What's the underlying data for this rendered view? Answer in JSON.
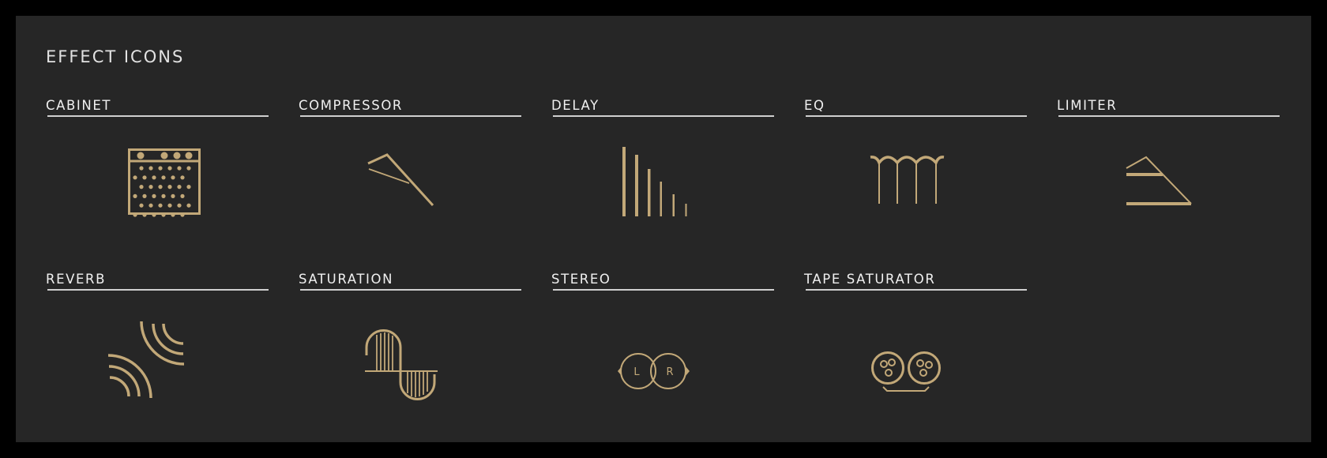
{
  "page": {
    "title": "EFFECT ICONS"
  },
  "colors": {
    "background": "#000000",
    "panel": "#262626",
    "icon": "#c2a878",
    "text": "#efefef",
    "rule": "#cfcfcf"
  },
  "effects": [
    {
      "label": "CABINET",
      "icon": "cabinet-icon"
    },
    {
      "label": "COMPRESSOR",
      "icon": "compressor-icon"
    },
    {
      "label": "DELAY",
      "icon": "delay-icon"
    },
    {
      "label": "EQ",
      "icon": "eq-icon"
    },
    {
      "label": "LIMITER",
      "icon": "limiter-icon"
    },
    {
      "label": "REVERB",
      "icon": "reverb-icon"
    },
    {
      "label": "SATURATION",
      "icon": "saturation-icon"
    },
    {
      "label": "STEREO",
      "icon": "stereo-icon",
      "channels": [
        "L",
        "R"
      ]
    },
    {
      "label": "TAPE SATURATOR",
      "icon": "tape-saturator-icon"
    }
  ]
}
